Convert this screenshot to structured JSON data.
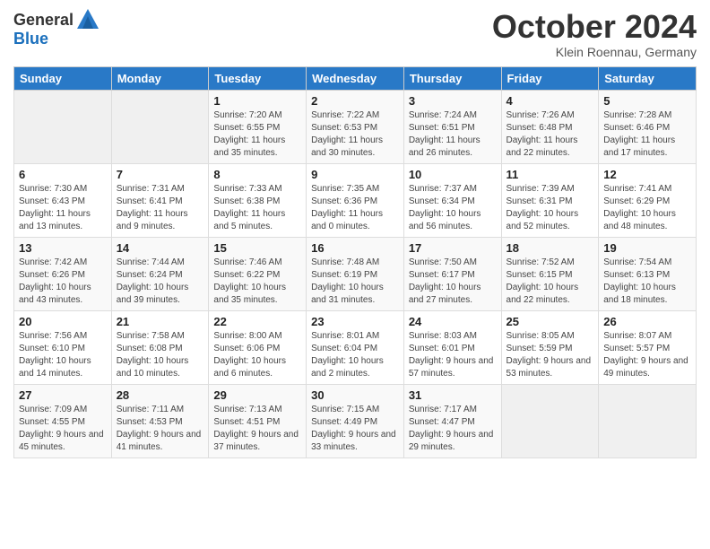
{
  "header": {
    "logo": {
      "general": "General",
      "blue": "Blue"
    },
    "title": "October 2024",
    "location": "Klein Roennau, Germany"
  },
  "weekdays": [
    "Sunday",
    "Monday",
    "Tuesday",
    "Wednesday",
    "Thursday",
    "Friday",
    "Saturday"
  ],
  "weeks": [
    [
      {
        "day": "",
        "info": ""
      },
      {
        "day": "",
        "info": ""
      },
      {
        "day": "1",
        "info": "Sunrise: 7:20 AM\nSunset: 6:55 PM\nDaylight: 11 hours and 35 minutes."
      },
      {
        "day": "2",
        "info": "Sunrise: 7:22 AM\nSunset: 6:53 PM\nDaylight: 11 hours and 30 minutes."
      },
      {
        "day": "3",
        "info": "Sunrise: 7:24 AM\nSunset: 6:51 PM\nDaylight: 11 hours and 26 minutes."
      },
      {
        "day": "4",
        "info": "Sunrise: 7:26 AM\nSunset: 6:48 PM\nDaylight: 11 hours and 22 minutes."
      },
      {
        "day": "5",
        "info": "Sunrise: 7:28 AM\nSunset: 6:46 PM\nDaylight: 11 hours and 17 minutes."
      }
    ],
    [
      {
        "day": "6",
        "info": "Sunrise: 7:30 AM\nSunset: 6:43 PM\nDaylight: 11 hours and 13 minutes."
      },
      {
        "day": "7",
        "info": "Sunrise: 7:31 AM\nSunset: 6:41 PM\nDaylight: 11 hours and 9 minutes."
      },
      {
        "day": "8",
        "info": "Sunrise: 7:33 AM\nSunset: 6:38 PM\nDaylight: 11 hours and 5 minutes."
      },
      {
        "day": "9",
        "info": "Sunrise: 7:35 AM\nSunset: 6:36 PM\nDaylight: 11 hours and 0 minutes."
      },
      {
        "day": "10",
        "info": "Sunrise: 7:37 AM\nSunset: 6:34 PM\nDaylight: 10 hours and 56 minutes."
      },
      {
        "day": "11",
        "info": "Sunrise: 7:39 AM\nSunset: 6:31 PM\nDaylight: 10 hours and 52 minutes."
      },
      {
        "day": "12",
        "info": "Sunrise: 7:41 AM\nSunset: 6:29 PM\nDaylight: 10 hours and 48 minutes."
      }
    ],
    [
      {
        "day": "13",
        "info": "Sunrise: 7:42 AM\nSunset: 6:26 PM\nDaylight: 10 hours and 43 minutes."
      },
      {
        "day": "14",
        "info": "Sunrise: 7:44 AM\nSunset: 6:24 PM\nDaylight: 10 hours and 39 minutes."
      },
      {
        "day": "15",
        "info": "Sunrise: 7:46 AM\nSunset: 6:22 PM\nDaylight: 10 hours and 35 minutes."
      },
      {
        "day": "16",
        "info": "Sunrise: 7:48 AM\nSunset: 6:19 PM\nDaylight: 10 hours and 31 minutes."
      },
      {
        "day": "17",
        "info": "Sunrise: 7:50 AM\nSunset: 6:17 PM\nDaylight: 10 hours and 27 minutes."
      },
      {
        "day": "18",
        "info": "Sunrise: 7:52 AM\nSunset: 6:15 PM\nDaylight: 10 hours and 22 minutes."
      },
      {
        "day": "19",
        "info": "Sunrise: 7:54 AM\nSunset: 6:13 PM\nDaylight: 10 hours and 18 minutes."
      }
    ],
    [
      {
        "day": "20",
        "info": "Sunrise: 7:56 AM\nSunset: 6:10 PM\nDaylight: 10 hours and 14 minutes."
      },
      {
        "day": "21",
        "info": "Sunrise: 7:58 AM\nSunset: 6:08 PM\nDaylight: 10 hours and 10 minutes."
      },
      {
        "day": "22",
        "info": "Sunrise: 8:00 AM\nSunset: 6:06 PM\nDaylight: 10 hours and 6 minutes."
      },
      {
        "day": "23",
        "info": "Sunrise: 8:01 AM\nSunset: 6:04 PM\nDaylight: 10 hours and 2 minutes."
      },
      {
        "day": "24",
        "info": "Sunrise: 8:03 AM\nSunset: 6:01 PM\nDaylight: 9 hours and 57 minutes."
      },
      {
        "day": "25",
        "info": "Sunrise: 8:05 AM\nSunset: 5:59 PM\nDaylight: 9 hours and 53 minutes."
      },
      {
        "day": "26",
        "info": "Sunrise: 8:07 AM\nSunset: 5:57 PM\nDaylight: 9 hours and 49 minutes."
      }
    ],
    [
      {
        "day": "27",
        "info": "Sunrise: 7:09 AM\nSunset: 4:55 PM\nDaylight: 9 hours and 45 minutes."
      },
      {
        "day": "28",
        "info": "Sunrise: 7:11 AM\nSunset: 4:53 PM\nDaylight: 9 hours and 41 minutes."
      },
      {
        "day": "29",
        "info": "Sunrise: 7:13 AM\nSunset: 4:51 PM\nDaylight: 9 hours and 37 minutes."
      },
      {
        "day": "30",
        "info": "Sunrise: 7:15 AM\nSunset: 4:49 PM\nDaylight: 9 hours and 33 minutes."
      },
      {
        "day": "31",
        "info": "Sunrise: 7:17 AM\nSunset: 4:47 PM\nDaylight: 9 hours and 29 minutes."
      },
      {
        "day": "",
        "info": ""
      },
      {
        "day": "",
        "info": ""
      }
    ]
  ]
}
